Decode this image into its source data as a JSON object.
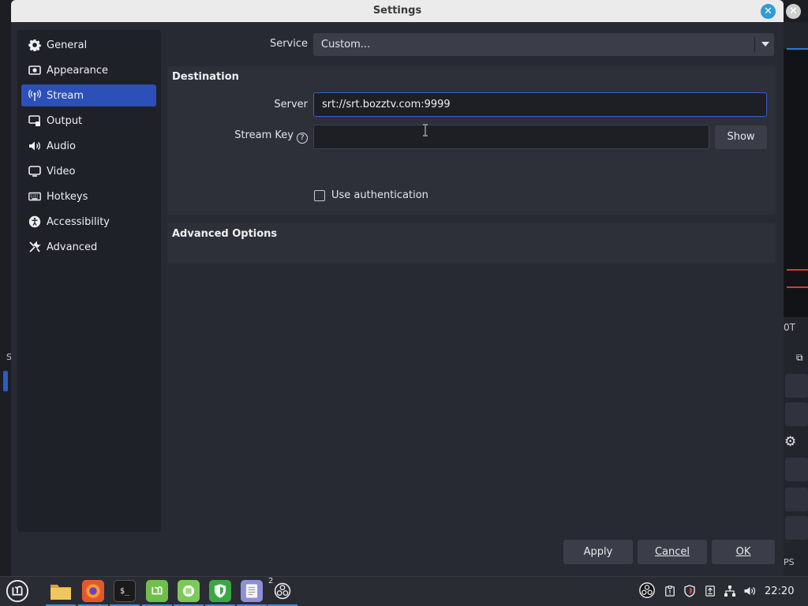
{
  "window": {
    "title": "Settings"
  },
  "sidebar": {
    "items": [
      {
        "label": "General",
        "icon": "gear-icon",
        "active": false
      },
      {
        "label": "Appearance",
        "icon": "appearance-icon",
        "active": false
      },
      {
        "label": "Stream",
        "icon": "antenna-icon",
        "active": true
      },
      {
        "label": "Output",
        "icon": "output-icon",
        "active": false
      },
      {
        "label": "Audio",
        "icon": "speaker-icon",
        "active": false
      },
      {
        "label": "Video",
        "icon": "monitor-icon",
        "active": false
      },
      {
        "label": "Hotkeys",
        "icon": "keyboard-icon",
        "active": false
      },
      {
        "label": "Accessibility",
        "icon": "accessibility-icon",
        "active": false
      },
      {
        "label": "Advanced",
        "icon": "wrench-icon",
        "active": false
      }
    ]
  },
  "service": {
    "label": "Service",
    "value": "Custom..."
  },
  "destination": {
    "title": "Destination",
    "server_label": "Server",
    "server_value": "srt://srt.bozztv.com:9999",
    "stream_key_label": "Stream Key",
    "stream_key_value": "",
    "show_button": "Show",
    "use_auth_label": "Use authentication",
    "use_auth_checked": false
  },
  "advanced_options": {
    "title": "Advanced Options"
  },
  "footer": {
    "apply": "Apply",
    "cancel": "Cancel",
    "ok": "OK"
  },
  "background": {
    "cut_text_1": "0T",
    "cut_text_2": "PS",
    "cut_text_3": "S"
  },
  "taskbar": {
    "apps": [
      "mint-menu-icon",
      "files-icon",
      "firefox-icon",
      "terminal-icon",
      "mint-update-icon",
      "spreadsheet-icon",
      "shield-icon",
      "text-editor-icon",
      "obs-icon"
    ],
    "obs_badge": "2",
    "tray": [
      "obs-tray-icon",
      "clipboard-icon",
      "shield-tray-icon",
      "update-icon",
      "network-icon",
      "volume-icon"
    ],
    "clock": "22:20"
  },
  "colors": {
    "accent": "#2c4fb8",
    "background": "#272a33",
    "panel": "#2d3039"
  }
}
